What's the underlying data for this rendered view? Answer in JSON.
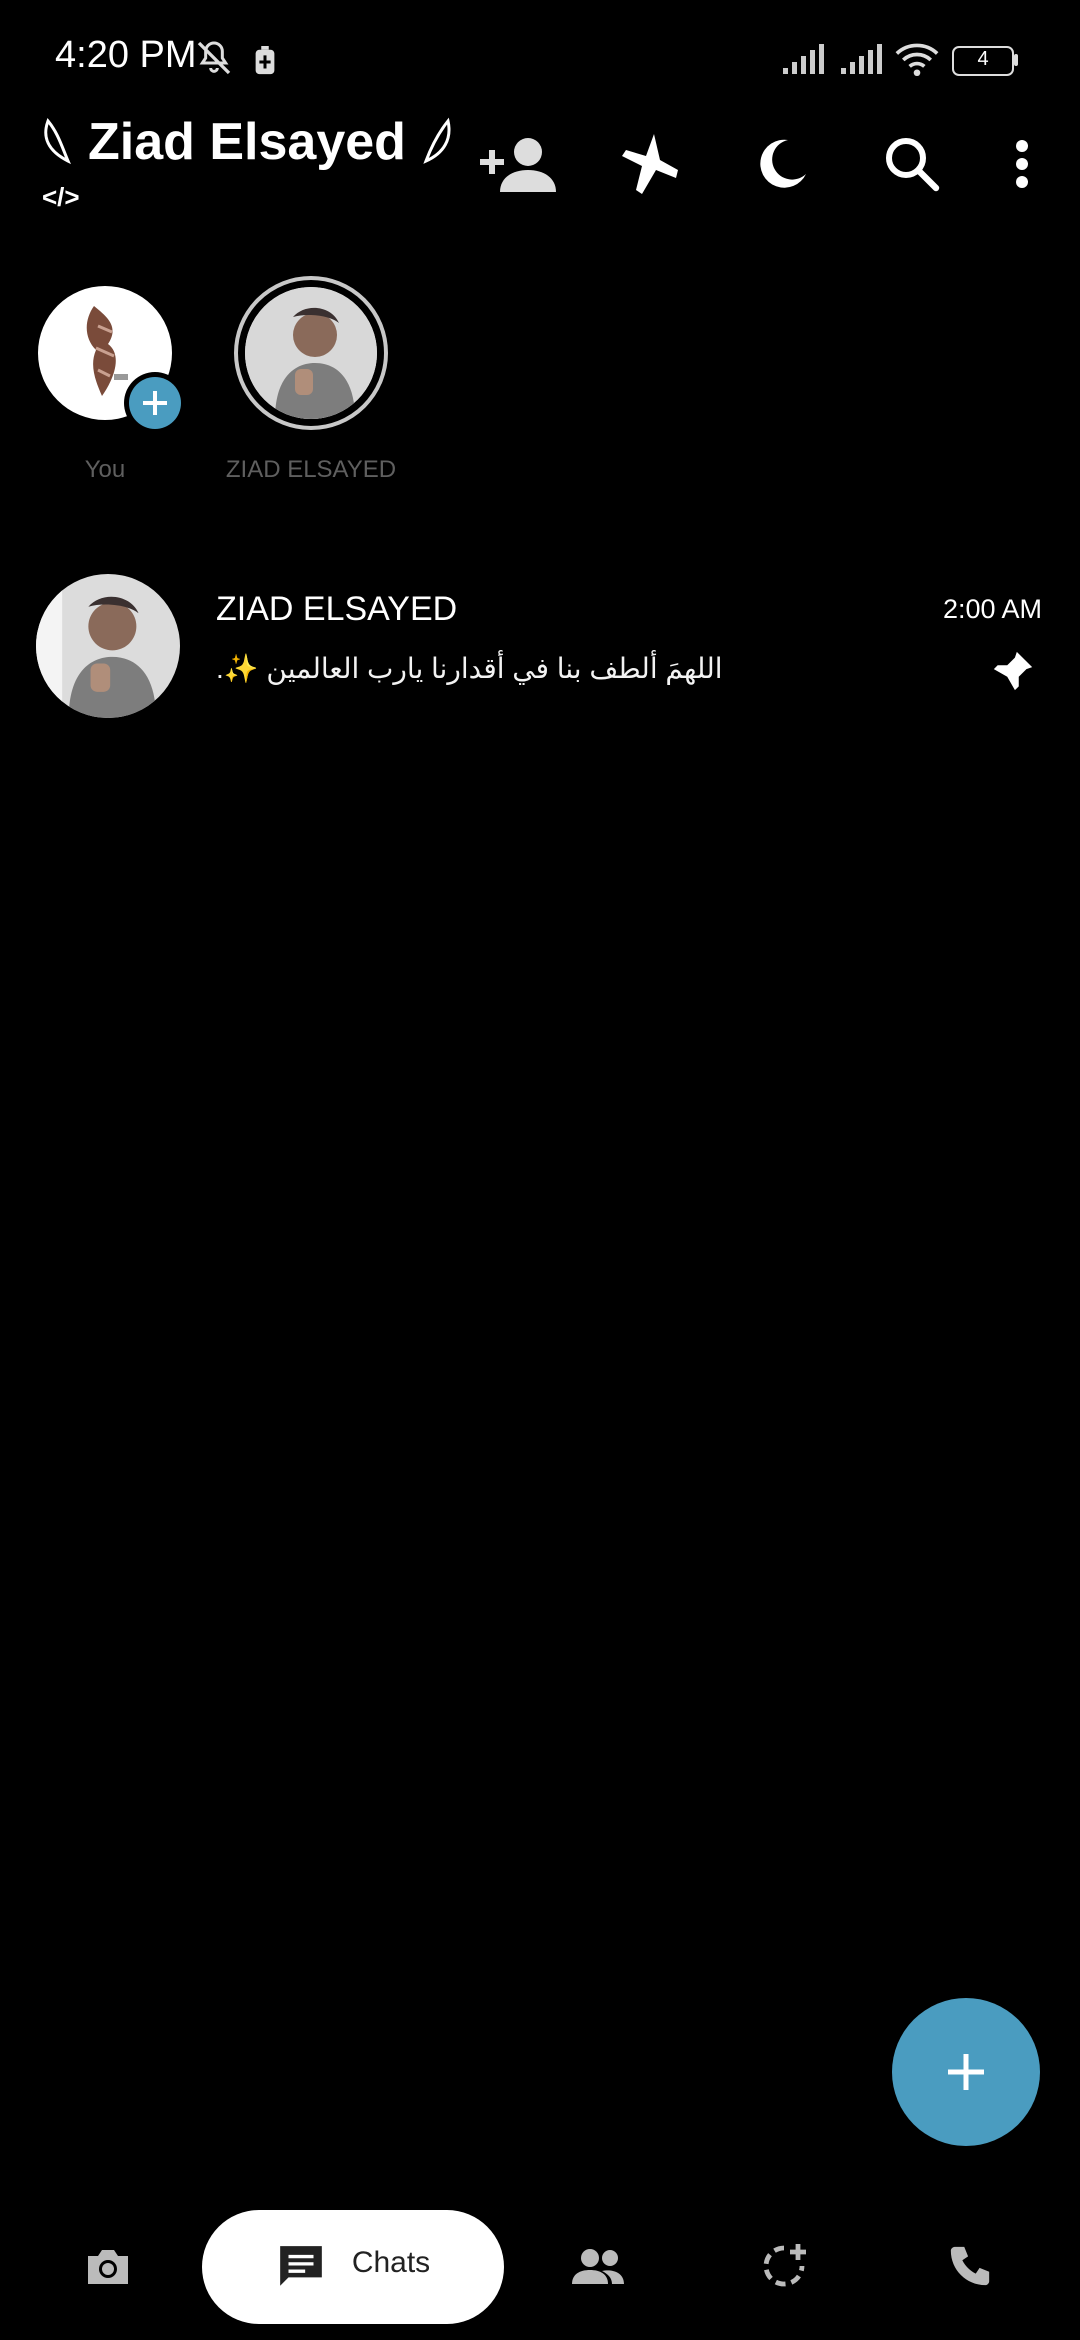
{
  "status_bar": {
    "time": "4:20 PM",
    "battery": "4",
    "icons": [
      "mute-icon",
      "battery-saver-icon",
      "signal-icon",
      "signal-icon",
      "wifi-icon",
      "battery-icon"
    ]
  },
  "header": {
    "title": "Ziad Elsayed",
    "subtitle": "</>",
    "actions": [
      "add-contact-icon",
      "airplane-icon",
      "moon-icon",
      "search-icon",
      "more-vert-icon"
    ]
  },
  "stories": [
    {
      "label": "You",
      "has_add_badge": true
    },
    {
      "label": "ZIAD ELSAYED",
      "has_ring": true
    }
  ],
  "chats": [
    {
      "name": "ZIAD ELSAYED",
      "time": "2:00 AM",
      "preview": "اللهمَ ألطف بنا في أقدارنا يارب العالمين ✨.",
      "pinned": true
    }
  ],
  "bottom_nav": {
    "active_label": "Chats",
    "items": [
      "camera-icon",
      "chats-icon",
      "people-icon",
      "status-icon",
      "phone-icon"
    ]
  },
  "colors": {
    "background": "#000000",
    "accent": "#4a9cc0",
    "muted_text": "#5f5f5f"
  }
}
